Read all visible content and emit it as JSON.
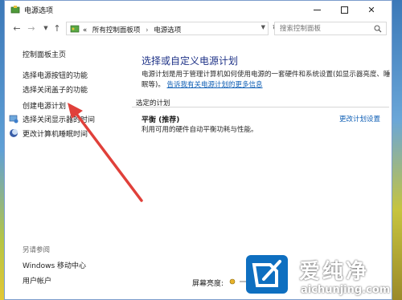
{
  "window": {
    "title": "电源选项"
  },
  "address": {
    "crumbs_prefix": "«",
    "crumbs": [
      "所有控制面板项",
      "电源选项"
    ],
    "search_placeholder": "搜索控制面板"
  },
  "left": {
    "home": "控制面板主页",
    "tasks": [
      "选择电源按钮的功能",
      "选择关闭盖子的功能",
      "创建电源计划",
      "选择关闭显示器的时间",
      "更改计算机睡眠时间"
    ],
    "see_also_title": "另请参阅",
    "see_also": [
      "Windows 移动中心",
      "用户帐户"
    ]
  },
  "main": {
    "heading": "选择或自定义电源计划",
    "desc_text": "电源计划是用于管理计算机如何使用电源的一套硬件和系统设置(如显示器亮度、睡眠等)。",
    "desc_link": "告诉我有关电源计划的更多信息",
    "section_label": "选定的计划",
    "plan_name": "平衡 (推荐)",
    "plan_desc": "利用可用的硬件自动平衡功耗与性能。",
    "plan_change": "更改计划设置",
    "brightness_label": "屏幕亮度:"
  },
  "watermark": {
    "brand": "爱纯净",
    "url": "aichunjing.com"
  },
  "colors": {
    "link": "#0f5fb5",
    "heading": "#1e3287",
    "annotation_arrow": "#e0403a",
    "watermark_logo": "#0e6fc0"
  }
}
